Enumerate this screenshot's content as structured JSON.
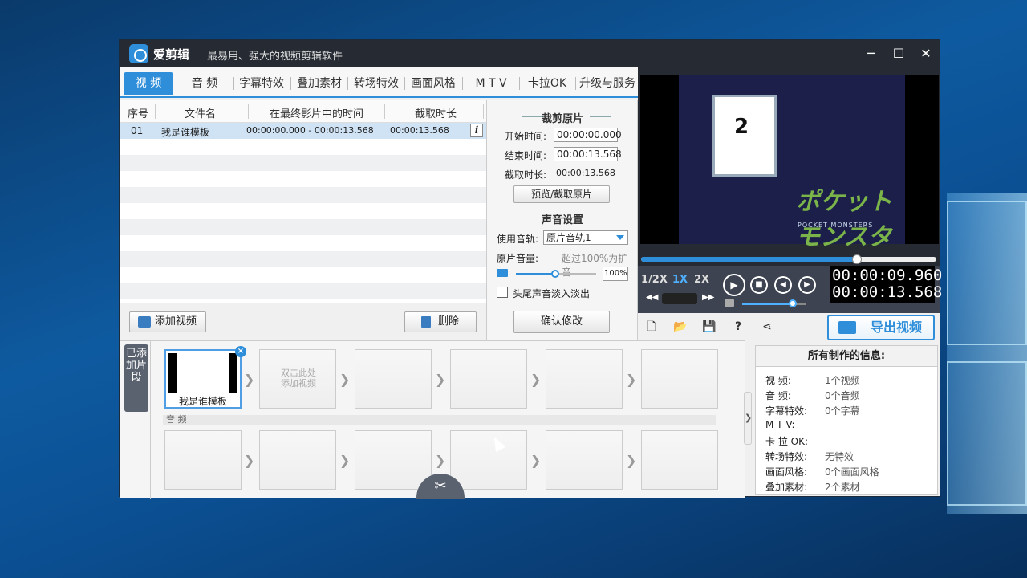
{
  "app": {
    "name": "爱剪辑",
    "subtitle": "最易用、强大的视频剪辑软件"
  },
  "window_buttons": {
    "minimize": "─",
    "maximize": "☐",
    "close": "✕"
  },
  "tabs": [
    {
      "label": "视  频",
      "active": true
    },
    {
      "label": "音  频"
    },
    {
      "label": "字幕特效"
    },
    {
      "label": "叠加素材"
    },
    {
      "label": "转场特效"
    },
    {
      "label": "画面风格"
    },
    {
      "label": "M T V"
    },
    {
      "label": "卡拉OK"
    },
    {
      "label": "升级与服务"
    }
  ],
  "file_list": {
    "headers": [
      "序号",
      "文件名",
      "在最终影片中的时间",
      "截取时长"
    ],
    "rows": [
      {
        "index": "01",
        "name": "我是谁模板",
        "time_range": "00:00:00.000 - 00:00:13.568",
        "duration": "00:00:13.568",
        "info": "i"
      }
    ]
  },
  "file_buttons": {
    "add": "添加视频",
    "delete": "删除"
  },
  "trim": {
    "title": "裁剪原片",
    "start_label": "开始时间:",
    "start_value": "00:00:00.000",
    "end_label": "结束时间:",
    "end_value": "00:00:13.568",
    "duration_label": "截取时长:",
    "duration_value": "00:00:13.568",
    "preview_button": "预览/截取原片",
    "audio_title": "声音设置",
    "track_label": "使用音轨:",
    "track_value": "原片音轨1",
    "volume_label": "原片音量:",
    "volume_hint": "超过100%为扩音",
    "volume_value": "100%",
    "volume_level": 0.5,
    "fade_label": "头尾声音淡入淡出",
    "confirm_button": "确认修改"
  },
  "player": {
    "card_number": "2",
    "logo_text": "ポケットモンスター",
    "logo_sub": "POCKET MONSTERS",
    "progress": 0.73,
    "speeds": [
      {
        "label": "1/2X"
      },
      {
        "label": "1X",
        "active": true
      },
      {
        "label": "2X"
      }
    ],
    "current_time": "00:00:09.960",
    "total_time": "00:00:13.568",
    "volume_level": 0.8,
    "export_button": "导出视频"
  },
  "timeline": {
    "side_label": "已添加片段",
    "first_clip_label": "我是谁模板",
    "add_hint": "双击此处\n添加视频",
    "audio_label": "音 频"
  },
  "info_panel": {
    "title": "所有制作的信息:",
    "rows": [
      {
        "label": "视    频:",
        "value": "1个视频"
      },
      {
        "label": "音    频:",
        "value": "0个音频"
      },
      {
        "label": "字幕特效:",
        "value": "0个字幕"
      },
      {
        "label": "M  T  V:",
        "value": ""
      },
      {
        "label": "卡 拉 OK:",
        "value": ""
      },
      {
        "label": "转场特效:",
        "value": "无特效"
      },
      {
        "label": "画面风格:",
        "value": "0个画面风格"
      },
      {
        "label": "叠加素材:",
        "value": "2个素材"
      }
    ]
  }
}
